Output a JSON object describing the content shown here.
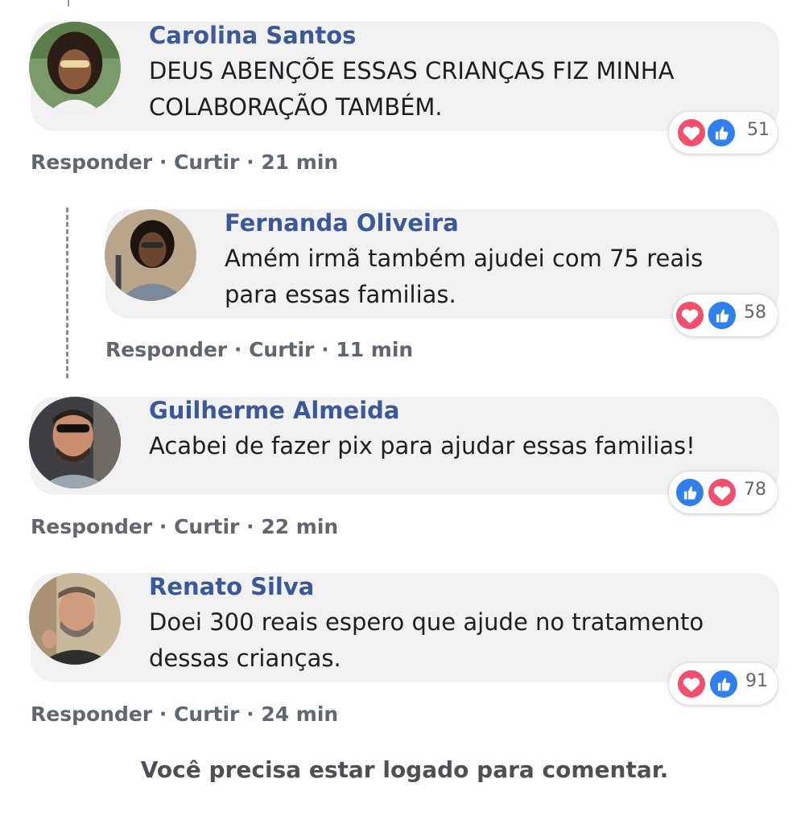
{
  "comments": [
    {
      "author": "Carolina Santos",
      "text_line1": "DEUS ABENÇÕE ESSAS CRIANÇAS FIZ MINHA",
      "text_line2": "COLABORAÇÃO TAMBÉM.",
      "reactions": [
        "love",
        "like"
      ],
      "reaction_count": "51",
      "reply_label": "Responder",
      "like_label": "Curtir",
      "time": "21 min"
    },
    {
      "author": "Fernanda Oliveira",
      "text_line1": "Amém irmã também ajudei com 75 reais",
      "text_line2": "para essas familias.",
      "reactions": [
        "love",
        "like"
      ],
      "reaction_count": "58",
      "reply_label": "Responder",
      "like_label": "Curtir",
      "time": "11 min"
    },
    {
      "author": "Guilherme Almeida",
      "text_line1": "Acabei de fazer pix para ajudar essas familias!",
      "reactions": [
        "like",
        "love"
      ],
      "reaction_count": "78",
      "reply_label": "Responder",
      "like_label": "Curtir",
      "time": "22 min"
    },
    {
      "author": "Renato Silva",
      "text_line1": "Doei 300 reais espero que ajude no tratamento",
      "text_line2": "dessas crianças.",
      "reactions": [
        "love",
        "like"
      ],
      "reaction_count": "91",
      "reply_label": "Responder",
      "like_label": "Curtir",
      "time": "24 min"
    }
  ],
  "separator": "·",
  "footer": {
    "login_notice": "Você precisa estar logado para comentar."
  },
  "colors": {
    "author": "#3b5998",
    "bubble": "#f1f1f2",
    "love": "#f0506e",
    "like": "#2f80ed",
    "meta": "#606770"
  }
}
